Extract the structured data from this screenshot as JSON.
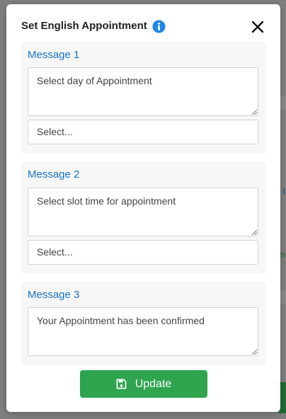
{
  "modal": {
    "title": "Set English Appointment",
    "info_icon": "info-circle-icon",
    "close_icon": "close-x-icon"
  },
  "sections": [
    {
      "label": "Message 1",
      "message": "Select day of Appointment",
      "select_placeholder": "Select..."
    },
    {
      "label": "Message 2",
      "message": "Select slot time for appointment",
      "select_placeholder": "Select..."
    },
    {
      "label": "Message 3",
      "message": "Your Appointment has been confirmed"
    }
  ],
  "actions": {
    "update_label": "Update",
    "update_icon": "floppy-disk-icon"
  },
  "colors": {
    "accent_blue": "#1a73c9",
    "info_blue": "#1e88e5",
    "button_green": "#2ea44f",
    "section_bg": "#f7f7f7"
  }
}
